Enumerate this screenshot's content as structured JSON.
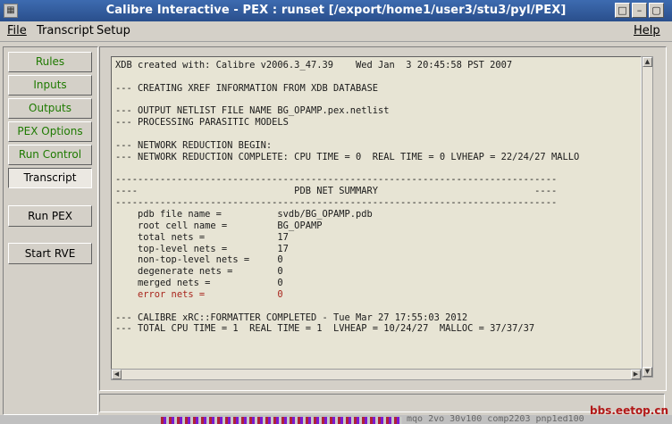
{
  "window": {
    "title": "Calibre Interactive - PEX : runset [/export/home1/user3/stu3/pyl/PEX]",
    "app_icon": "calibre-icon",
    "controls": [
      "window-icon",
      "minimize-icon",
      "maximize-icon",
      "close-icon"
    ]
  },
  "menu": {
    "file": "File",
    "transcript": "Transcript",
    "setup": "Setup",
    "help": "Help"
  },
  "sidebar": {
    "items": [
      {
        "label": "Rules",
        "color": "#1e7a00"
      },
      {
        "label": "Inputs",
        "color": "#1e7a00"
      },
      {
        "label": "Outputs",
        "color": "#1e7a00"
      },
      {
        "label": "PEX Options",
        "color": "#1e7a00"
      },
      {
        "label": "Run Control",
        "color": "#1e7a00"
      },
      {
        "label": "Transcript",
        "color": "#000000",
        "active": true
      }
    ],
    "run_button": "Run PEX",
    "rve_button": "Start RVE"
  },
  "transcript": {
    "lines": [
      "XDB created with: Calibre v2006.3_47.39    Wed Jan  3 20:45:58 PST 2007",
      "",
      "--- CREATING XREF INFORMATION FROM XDB DATABASE",
      "",
      "--- OUTPUT NETLIST FILE NAME BG_OPAMP.pex.netlist",
      "--- PROCESSING PARASITIC MODELS",
      "",
      "--- NETWORK REDUCTION BEGIN:",
      "--- NETWORK REDUCTION COMPLETE: CPU TIME = 0  REAL TIME = 0 LVHEAP = 22/24/27 MALLO",
      "",
      "-------------------------------------------------------------------------------",
      "----                            PDB NET SUMMARY                            ----",
      "-------------------------------------------------------------------------------",
      "    pdb file name =          svdb/BG_OPAMP.pdb",
      "    root cell name =         BG_OPAMP",
      "    total nets =             17",
      "    top-level nets =         17",
      "    non-top-level nets =     0",
      "    degenerate nets =        0",
      "    merged nets =            0",
      "    error nets =             0",
      "",
      "--- CALIBRE xRC::FORMATTER COMPLETED - Tue Mar 27 17:55:03 2012",
      "--- TOTAL CPU TIME = 1  REAL TIME = 1  LVHEAP = 10/24/27  MALLOC = 37/37/37"
    ],
    "error_line_index": 20,
    "error_color": "#a8241c"
  },
  "background_terminal_text": "mqo 2vo 30v100  comp2203  pnp1ed100",
  "watermark": "bbs.eetop.cn"
}
